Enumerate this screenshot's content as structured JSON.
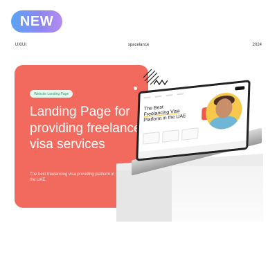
{
  "badge": {
    "label": "NEW"
  },
  "meta": {
    "category": "UX/UI",
    "brand": "spacelance",
    "year": "2024"
  },
  "card": {
    "pill": "Website Landing Page",
    "title": "Landing Page for providing freelance visa services",
    "subtitle": "The best freelancing visa providing platform in the UAE"
  },
  "mockup": {
    "headline_pre": "The Best",
    "headline_highlight": "Freelancing Visa",
    "headline_post": "Platform in the UAE"
  },
  "colors": {
    "card_bg": "#f26a5d",
    "badge_gradient_start": "#5aa4f5",
    "badge_gradient_end": "#b58cee",
    "accent_yellow": "#f7c84a"
  }
}
